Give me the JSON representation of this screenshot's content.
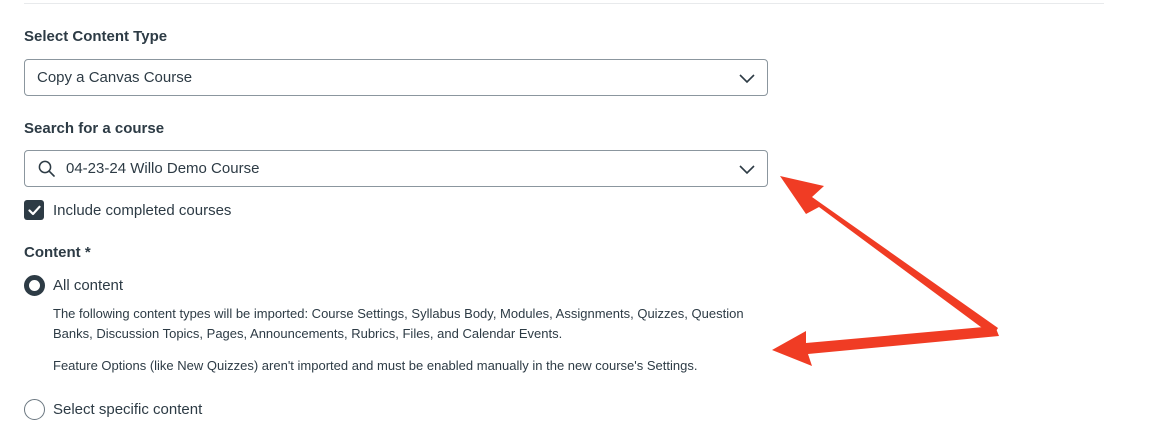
{
  "content_type": {
    "label": "Select Content Type",
    "selected": "Copy a Canvas Course"
  },
  "course_search": {
    "label": "Search for a course",
    "value": "04-23-24 Willo Demo Course"
  },
  "include_completed": {
    "label": "Include completed courses",
    "checked": true
  },
  "content": {
    "label": "Content *",
    "options": [
      {
        "label": "All content",
        "selected": true,
        "description": "The following content types will be imported: Course Settings, Syllabus Body, Modules, Assignments, Quizzes, Question Banks, Discussion Topics, Pages, Announcements, Rubrics, Files, and Calendar Events.",
        "note": "Feature Options (like New Quizzes) aren't imported and must be enabled manually in the new course's Settings."
      },
      {
        "label": "Select specific content",
        "selected": false
      }
    ]
  },
  "colors": {
    "text": "#2d3b45",
    "border": "#8b969e",
    "annotation_arrow": "#f03c24"
  },
  "icons": [
    "chevron-down-icon",
    "search-icon",
    "checkmark-icon"
  ]
}
